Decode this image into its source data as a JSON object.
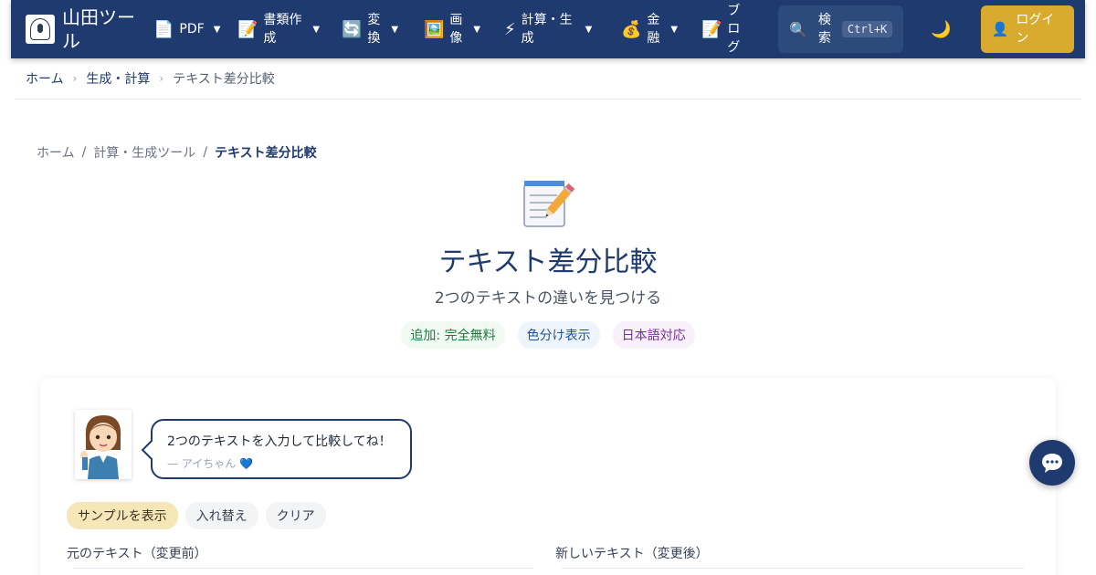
{
  "brand": {
    "name": "山田ツール"
  },
  "nav": {
    "items": [
      {
        "icon": "📄",
        "label": "PDF"
      },
      {
        "icon": "📝",
        "label": "書類作成"
      },
      {
        "icon": "🔄",
        "label": "変換"
      },
      {
        "icon": "🖼️",
        "label": "画像"
      },
      {
        "icon": "⚡",
        "label": "計算・生成"
      },
      {
        "icon": "💰",
        "label": "金融"
      },
      {
        "icon": "📝",
        "label": "ブログ"
      }
    ],
    "caret": "▼",
    "search_icon": "🔍",
    "search_label": "検索",
    "search_shortcut": "Ctrl+K",
    "theme_icon": "🌙",
    "login_icon": "👤",
    "login_label": "ログイン"
  },
  "breadcrumb_top": {
    "home": "ホーム",
    "section": "生成・計算",
    "current": "テキスト差分比較",
    "separator": "›"
  },
  "breadcrumb_page": {
    "home": "ホーム",
    "section": "計算・生成ツール",
    "current": "テキスト差分比較",
    "separator": "/"
  },
  "hero": {
    "title": "テキスト差分比較",
    "subtitle": "2つのテキストの違いを見つける",
    "badges": [
      "追加: 完全無料",
      "色分け表示",
      "日本語対応"
    ]
  },
  "mascot": {
    "message": "2つのテキストを入力して比較してね！",
    "signature": "— アイちゃん 💙"
  },
  "actions": {
    "sample": "サンプルを表示",
    "swap": "入れ替え",
    "clear": "クリア"
  },
  "editor": {
    "left_label": "元のテキスト（変更前）",
    "right_label": "新しいテキスト（変更後）"
  },
  "colors": {
    "nav_bg": "#1e3a6e",
    "accent_gold": "#d8ab2f",
    "title": "#1e3a6e"
  }
}
